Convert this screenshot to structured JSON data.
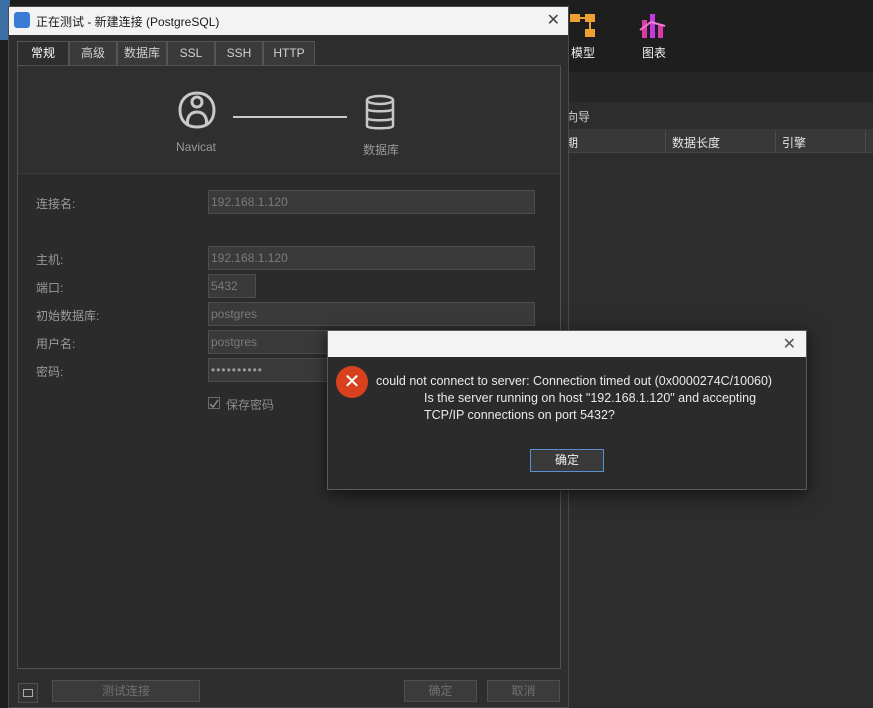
{
  "app": {
    "toolbar": {
      "model_label": "模型",
      "chart_label": "图表"
    },
    "wizard_label": "向导",
    "columns": [
      "期",
      "数据长度",
      "引擎"
    ]
  },
  "dialog": {
    "title": "正在测试 - 新建连接 (PostgreSQL)",
    "tabs": [
      "常规",
      "高级",
      "数据库",
      "SSL",
      "SSH",
      "HTTP"
    ],
    "hero": {
      "left_label": "Navicat",
      "right_label": "数据库"
    },
    "fields": {
      "connection_name": {
        "label": "连接名:",
        "value": "192.168.1.120"
      },
      "host": {
        "label": "主机:",
        "value": "192.168.1.120"
      },
      "port": {
        "label": "端口:",
        "value": "5432"
      },
      "initial_db": {
        "label": "初始数据库:",
        "value": "postgres"
      },
      "username": {
        "label": "用户名:",
        "value": "postgres"
      },
      "password": {
        "label": "密码:",
        "value": "••••••••••"
      }
    },
    "save_password_label": "保存密码",
    "buttons": {
      "test": "测试连接",
      "ok": "确定",
      "cancel": "取消"
    }
  },
  "alert": {
    "line1": "could not connect to server: Connection timed out (0x0000274C/10060)",
    "line2": "Is the server running on host \"192.168.1.120\" and accepting",
    "line3": "TCP/IP connections on port 5432?",
    "ok_label": "确定",
    "colors": {
      "error": "#d9411e",
      "accent": "#5a8fd0"
    }
  }
}
